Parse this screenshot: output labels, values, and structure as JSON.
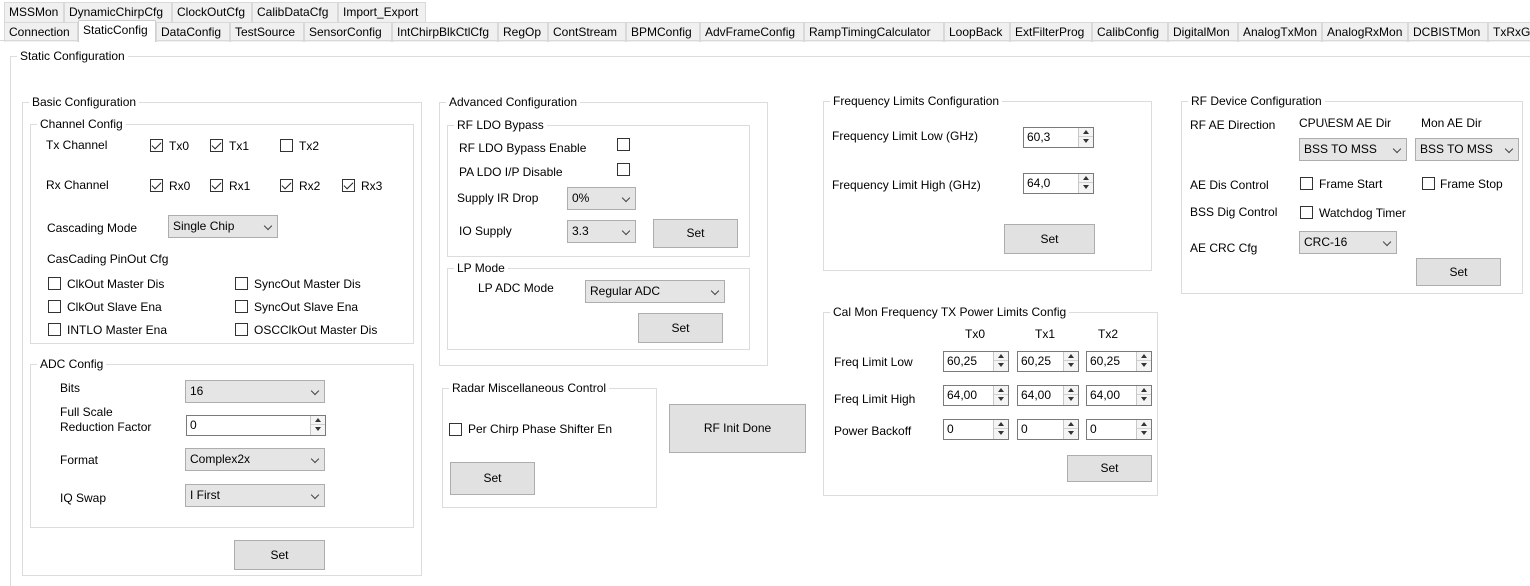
{
  "tabs_row1": [
    "MSSMon",
    "DynamicChirpCfg",
    "ClockOutCfg",
    "CalibDataCfg",
    "Import_Export"
  ],
  "tabs_row2": [
    "Connection",
    "StaticConfig",
    "DataConfig",
    "TestSource",
    "SensorConfig",
    "IntChirpBlkCtlCfg",
    "RegOp",
    "ContStream",
    "BPMConfig",
    "AdvFrameConfig",
    "RampTimingCalculator",
    "LoopBack",
    "ExtFilterProg",
    "CalibConfig",
    "DigitalMon",
    "AnalogTxMon",
    "AnalogRxMon",
    "DCBISTMon",
    "TxRxG"
  ],
  "static_config": {
    "title": "Static Configuration"
  },
  "basic": {
    "title": "Basic Configuration",
    "channel_title": "Channel Config",
    "tx_label": "Tx Channel",
    "tx": [
      {
        "label": "Tx0",
        "checked": true
      },
      {
        "label": "Tx1",
        "checked": true
      },
      {
        "label": "Tx2",
        "checked": false
      }
    ],
    "rx_label": "Rx Channel",
    "rx": [
      {
        "label": "Rx0",
        "checked": true
      },
      {
        "label": "Rx1",
        "checked": true
      },
      {
        "label": "Rx2",
        "checked": true
      },
      {
        "label": "Rx3",
        "checked": true
      }
    ],
    "cascading_label": "Cascading Mode",
    "cascading_value": "Single Chip",
    "pinout_label": "CasCading PinOut Cfg",
    "pinout": [
      {
        "label": "ClkOut Master Dis",
        "checked": false
      },
      {
        "label": "SyncOut Master Dis",
        "checked": false
      },
      {
        "label": "ClkOut Slave Ena",
        "checked": false
      },
      {
        "label": "SyncOut Slave Ena",
        "checked": false
      },
      {
        "label": "INTLO Master Ena",
        "checked": false
      },
      {
        "label": "OSCClkOut Master Dis",
        "checked": false
      }
    ],
    "adc": {
      "title": "ADC Config",
      "bits_label": "Bits",
      "bits_value": "16",
      "fsrf_label_1": "Full Scale",
      "fsrf_label_2": "Reduction Factor",
      "fsrf_value": "0",
      "format_label": "Format",
      "format_value": "Complex2x",
      "iq_label": "IQ Swap",
      "iq_value": "I First"
    },
    "set_label": "Set"
  },
  "advanced": {
    "title": "Advanced Configuration",
    "ldo_title": "RF LDO Bypass",
    "ldo_bypass_label": "RF LDO Bypass Enable",
    "ldo_bypass_checked": false,
    "pa_ldo_label": "PA LDO I/P Disable",
    "pa_ldo_checked": false,
    "supply_ir_label": "Supply IR Drop",
    "supply_ir_value": "0%",
    "io_supply_label": "IO Supply",
    "io_supply_value": "3.3",
    "ldo_set_label": "Set",
    "lp_title": "LP Mode",
    "lp_adc_label": "LP ADC Mode",
    "lp_adc_value": "Regular ADC",
    "lp_set_label": "Set"
  },
  "radar_misc": {
    "title": "Radar Miscellaneous Control",
    "phase_shifter_label": "Per Chirp Phase Shifter En",
    "phase_shifter_checked": false,
    "set_label": "Set"
  },
  "rf_init_done": "RF Init Done",
  "freq_limits": {
    "title": "Frequency Limits Configuration",
    "low_label": "Frequency Limit Low (GHz)",
    "low_value": "60,3",
    "high_label": "Frequency Limit High (GHz)",
    "high_value": "64,0",
    "set_label": "Set"
  },
  "cal_mon": {
    "title": "Cal Mon Frequency TX Power Limits Config",
    "columns": [
      "Tx0",
      "Tx1",
      "Tx2"
    ],
    "rows": [
      {
        "label": "Freq Limit Low",
        "values": [
          "60,25",
          "60,25",
          "60,25"
        ]
      },
      {
        "label": "Freq Limit High",
        "values": [
          "64,00",
          "64,00",
          "64,00"
        ]
      },
      {
        "label": "Power Backoff",
        "values": [
          "0",
          "0",
          "0"
        ]
      }
    ],
    "set_label": "Set"
  },
  "rf_device": {
    "title": "RF Device Configuration",
    "ae_dir_label": "RF AE Direction",
    "cpu_esm_label": "CPU\\ESM AE Dir",
    "cpu_esm_value": "BSS TO MSS",
    "mon_ae_label": "Mon AE Dir",
    "mon_ae_value": "BSS TO MSS",
    "ae_dis_label": "AE Dis Control",
    "frame_start_label": "Frame Start",
    "frame_start_checked": false,
    "frame_stop_label": "Frame Stop",
    "frame_stop_checked": false,
    "bss_dig_label": "BSS Dig Control",
    "watchdog_label": "Watchdog Timer",
    "watchdog_checked": false,
    "crc_label": "AE CRC Cfg",
    "crc_value": "CRC-16",
    "set_label": "Set"
  }
}
